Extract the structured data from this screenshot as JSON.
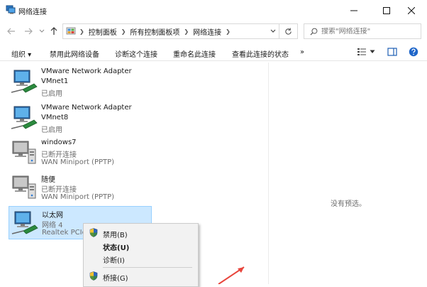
{
  "window": {
    "title": "网络连接",
    "minimize_icon": "minimize-icon",
    "maximize_icon": "maximize-icon",
    "close_icon": "close-icon"
  },
  "address_bar": {
    "breadcrumbs": [
      "控制面板",
      "所有控制面板项",
      "网络连接"
    ],
    "search_placeholder": "搜索\"网络连接\""
  },
  "commands": {
    "organize": "组织 ▾",
    "disable": "禁用此网络设备",
    "diagnose": "诊断这个连接",
    "rename": "重命名此连接",
    "view_status": "查看此连接的状态",
    "more": "»"
  },
  "connections": [
    {
      "name": "VMware Network Adapter",
      "line2": "VMnet1",
      "status": "已启用"
    },
    {
      "name": "VMware Network Adapter",
      "line2": "VMnet8",
      "status": "已启用"
    },
    {
      "name": "windows7",
      "line2": "已断开连接",
      "status": "WAN Miniport (PPTP)"
    },
    {
      "name": "随便",
      "line2": "已断开连接",
      "status": "WAN Miniport (PPTP)"
    },
    {
      "name": "以太网",
      "line2": "网络 4",
      "status": "Realtek PCIe"
    }
  ],
  "preview_text": "没有预选。",
  "context_menu": {
    "disable": "禁用(B)",
    "status": "状态(U)",
    "diagnose": "诊断(I)",
    "bridge": "桥接(G)"
  },
  "colors": {
    "selection_bg": "#cce8ff",
    "selection_border": "#99d1ff",
    "arrow": "#e8453c"
  }
}
